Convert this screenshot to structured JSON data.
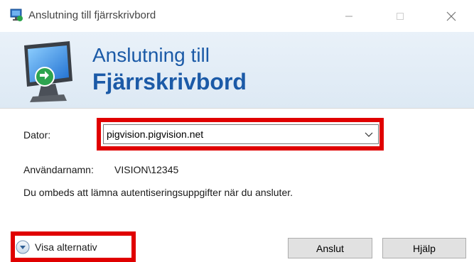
{
  "window": {
    "title": "Anslutning till fjärrskrivbord",
    "controls": {
      "minimize_icon": "minimize-icon",
      "maximize_icon": "maximize-icon",
      "close_icon": "close-icon"
    }
  },
  "banner": {
    "line1": "Anslutning till",
    "line2": "Fjärrskrivbord",
    "color": "#1b5aa7"
  },
  "form": {
    "computer_label": "Dator:",
    "computer_value": "pigvision.pigvision.net",
    "username_label": "Användarnamn:",
    "username_value": "VISION\\12345",
    "info_text": "Du ombeds att lämna autentiseringsuppgifter när du ansluter."
  },
  "footer": {
    "options_label": "Visa alternativ",
    "connect_label": "Anslut",
    "help_label": "Hjälp"
  },
  "highlight_color": "#e00000"
}
